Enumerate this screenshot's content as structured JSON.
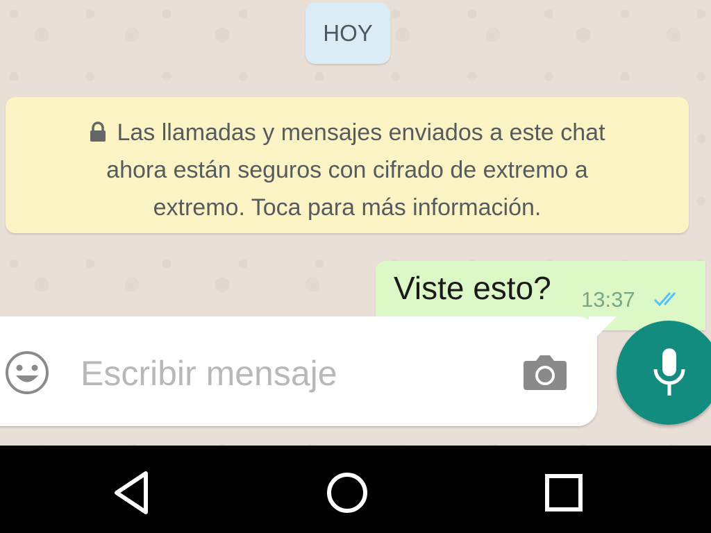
{
  "chat": {
    "date_chip": "HOY",
    "encryption_notice": {
      "icon": "lock-icon",
      "line1": "Las llamadas y mensajes enviados a este chat",
      "line2": "ahora están seguros con cifrado de extremo a",
      "line3": "extremo. Toca para más información."
    },
    "messages": [
      {
        "text": "Viste esto?",
        "time": "13:37",
        "status": "read",
        "status_icon": "double-check-icon"
      }
    ]
  },
  "composer": {
    "placeholder": "Escribir mensaje",
    "emoji_icon": "emoji-icon",
    "camera_icon": "camera-icon",
    "mic_icon": "mic-icon"
  },
  "nav": {
    "back_icon": "back-icon",
    "home_icon": "home-icon",
    "recent_icon": "recent-apps-icon"
  },
  "colors": {
    "accent": "#128c7e",
    "outgoing_bubble": "#dcf8c6",
    "notice_bubble": "#fcf4c5",
    "date_chip": "#dcecf6",
    "read_ticks": "#4fc3f7"
  }
}
